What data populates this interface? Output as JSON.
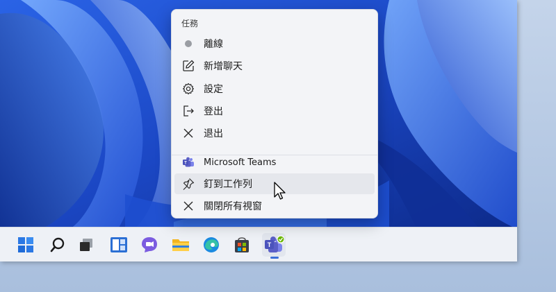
{
  "menu": {
    "header": "任務",
    "items": [
      {
        "label": "離線",
        "icon": "status-dot-icon"
      },
      {
        "label": "新增聊天",
        "icon": "compose-icon"
      },
      {
        "label": "設定",
        "icon": "gear-icon"
      },
      {
        "label": "登出",
        "icon": "sign-out-icon"
      },
      {
        "label": "退出",
        "icon": "close-icon"
      }
    ],
    "app_item": {
      "label": "Microsoft Teams",
      "icon": "teams-icon"
    },
    "pin_item": {
      "label": "釘到工作列",
      "icon": "pin-icon"
    },
    "close_all_item": {
      "label": "關閉所有視窗",
      "icon": "close-icon"
    }
  },
  "taskbar": {
    "icons": [
      "windows-start-icon",
      "search-icon",
      "task-view-icon",
      "widgets-icon",
      "chat-icon",
      "file-explorer-icon",
      "edge-icon",
      "store-icon",
      "teams-icon"
    ]
  },
  "colors": {
    "accent": "#3b6fd8",
    "menu_background": "#f3f4f7",
    "taskbar_background": "#eef1f6",
    "teams_purple": "#5b5fc7"
  }
}
